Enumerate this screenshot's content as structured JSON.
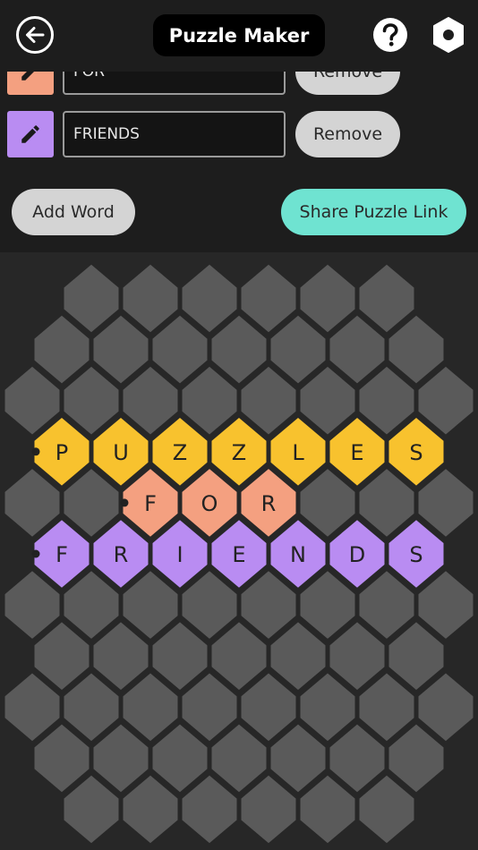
{
  "header": {
    "title": "Puzzle Maker",
    "back_icon": "arrow-left-circle-icon",
    "help_icon": "question-circle-icon",
    "settings_icon": "hexagon-gear-icon"
  },
  "editor": {
    "words": [
      {
        "value": "FOR",
        "color": "#f4a080",
        "remove_label": "Remove",
        "edit_icon": "pencil-icon"
      },
      {
        "value": "FRIENDS",
        "color": "#b98cf2",
        "remove_label": "Remove",
        "edit_icon": "pencil-icon"
      }
    ],
    "add_word_label": "Add Word",
    "share_label": "Share Puzzle Link"
  },
  "board": {
    "empty_color": "#5a5a5a",
    "words": [
      {
        "text": "PUZZLES",
        "color": "#f8c22e"
      },
      {
        "text": "FOR",
        "color": "#f4a080"
      },
      {
        "text": "FRIENDS",
        "color": "#b98cf2"
      }
    ]
  }
}
